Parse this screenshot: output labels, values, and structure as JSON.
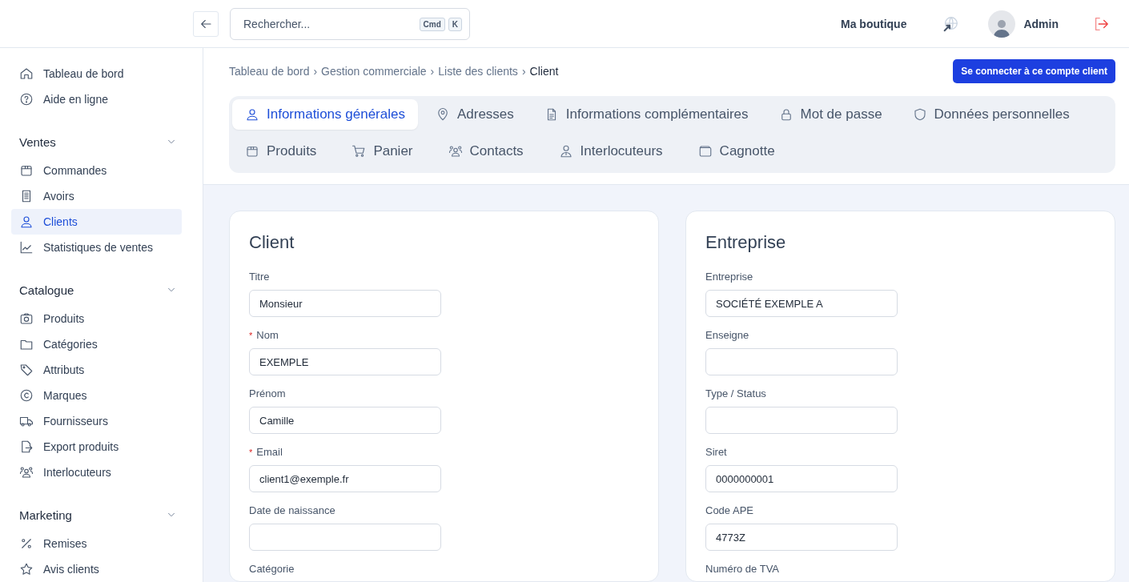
{
  "header": {
    "search": {
      "placeholder": "Rechercher...",
      "keys": [
        "Cmd",
        "K"
      ]
    },
    "shop": "Ma boutique",
    "user": "Admin"
  },
  "sidebar": {
    "groups": [
      {
        "items": [
          {
            "label": "Tableau de bord",
            "selected": false
          },
          {
            "label": "Aide en ligne",
            "selected": false
          }
        ]
      },
      {
        "title": "Ventes",
        "expanded": true,
        "items": [
          {
            "label": "Commandes",
            "selected": false
          },
          {
            "label": "Avoirs",
            "selected": false
          },
          {
            "label": "Clients",
            "selected": true
          },
          {
            "label": "Statistiques de ventes",
            "selected": false
          }
        ]
      },
      {
        "title": "Catalogue",
        "expanded": true,
        "items": [
          {
            "label": "Produits",
            "selected": false
          },
          {
            "label": "Catégories",
            "selected": false
          },
          {
            "label": "Attributs",
            "selected": false
          },
          {
            "label": "Marques",
            "selected": false
          },
          {
            "label": "Fournisseurs",
            "selected": false
          },
          {
            "label": "Export produits",
            "selected": false
          },
          {
            "label": "Interlocuteurs",
            "selected": false
          }
        ]
      },
      {
        "title": "Marketing",
        "expanded": true,
        "items": [
          {
            "label": "Remises",
            "selected": false
          },
          {
            "label": "Avis clients",
            "selected": false
          }
        ]
      }
    ]
  },
  "breadcrumb": {
    "separator": "›",
    "items": [
      "Tableau de bord",
      "Gestion commerciale",
      "Liste des clients",
      "Client"
    ]
  },
  "action_button": "Se connecter à ce compte client",
  "tabs": [
    {
      "label": "Informations générales",
      "selected": true
    },
    {
      "label": "Adresses",
      "selected": false
    },
    {
      "label": "Informations complémentaires",
      "selected": false
    },
    {
      "label": "Mot de passe",
      "selected": false
    },
    {
      "label": "Données personnelles",
      "selected": false
    },
    {
      "label": "Produits",
      "selected": false
    },
    {
      "label": "Panier",
      "selected": false
    },
    {
      "label": "Contacts",
      "selected": false
    },
    {
      "label": "Interlocuteurs",
      "selected": false
    },
    {
      "label": "Cagnotte",
      "selected": false
    }
  ],
  "cards": [
    {
      "title": "Client",
      "fields": [
        {
          "label": "Titre",
          "input": true,
          "value": "Monsieur"
        },
        {
          "label": "Nom",
          "required_mark": "*",
          "input": true,
          "value": "EXEMPLE"
        },
        {
          "label": "Prénom",
          "input": true,
          "value": "Camille"
        },
        {
          "label": "Email",
          "required_mark": "*",
          "input": true,
          "value": "client1@exemple.fr"
        },
        {
          "label": "Date de naissance",
          "input": true
        },
        {
          "label": "Catégorie"
        }
      ]
    },
    {
      "title": "Entreprise",
      "fields": [
        {
          "label": "Entreprise",
          "input": true,
          "value": "SOCIÉTÉ EXEMPLE A"
        },
        {
          "label": "Enseigne",
          "input": true
        },
        {
          "label": "Type / Status",
          "input": true
        },
        {
          "label": "Siret",
          "input": true,
          "value": "0000000001"
        },
        {
          "label": "Code APE",
          "input": true,
          "value": "4773Z"
        },
        {
          "label": "Numéro de TVA"
        }
      ]
    }
  ]
}
